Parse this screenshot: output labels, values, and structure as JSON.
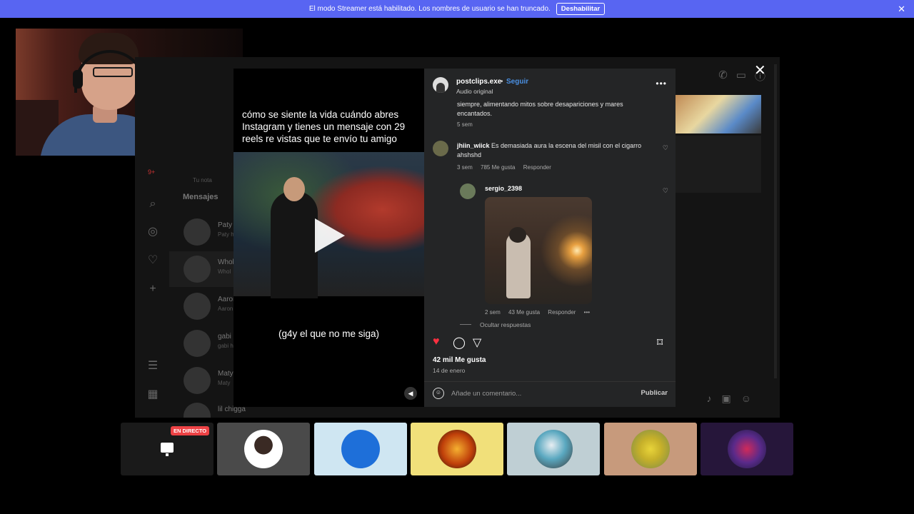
{
  "banner": {
    "message": "El modo Streamer está habilitado. Los nombres de usuario se han truncado.",
    "button": "Deshabilitar",
    "close": "✕"
  },
  "background_app": {
    "notification_count": "9+",
    "your_note": "Tu nota",
    "messages_title": "Mensajes",
    "dms": [
      {
        "name": "Paty",
        "preview": "Paty h"
      },
      {
        "name": "Whol",
        "preview": "Whol"
      },
      {
        "name": "Aaron",
        "preview": "Aaron"
      },
      {
        "name": "gabi",
        "preview": "gabi h"
      },
      {
        "name": "Maty",
        "preview": "Maty"
      },
      {
        "name": "lil chigga",
        "preview": ""
      }
    ]
  },
  "video": {
    "caption_top": "cómo se siente la vida cuándo abres Instagram y tienes un mensaje con 29 reels re vistas que te envío tu amigo",
    "caption_bottom": "(g4y el que no me siga)"
  },
  "post": {
    "username": "postclips.exe",
    "separator": "•",
    "follow": "Seguir",
    "audio": "Audio original",
    "more": "•••"
  },
  "comments": {
    "partial_text": "siempre, alimentando mitos sobre desapariciones y mares encantados.",
    "partial_age": "5 sem",
    "c1": {
      "user": "jhiin_wiick",
      "text": "Es demasiada aura la escena del misil con el cigarro ahshshd",
      "age": "3 sem",
      "likes": "785 Me gusta",
      "reply": "Responder"
    },
    "c2": {
      "user": "sergio_2398",
      "age": "2 sem",
      "likes": "43 Me gusta",
      "reply": "Responder",
      "more": "•••"
    },
    "hide_replies": "Ocultar respuestas"
  },
  "post_footer": {
    "likes": "42 mil Me gusta",
    "date": "14 de enero",
    "comment_placeholder": "Añade un comentario...",
    "publish": "Publicar"
  },
  "tiles": {
    "live_badge": "EN DIRECTO",
    "colors": [
      "#1a1a1a",
      "#4a4a4a",
      "#cfe6f2",
      "#f1e07a",
      "#bfcfd4",
      "#c79a7c",
      "#26163a"
    ]
  }
}
